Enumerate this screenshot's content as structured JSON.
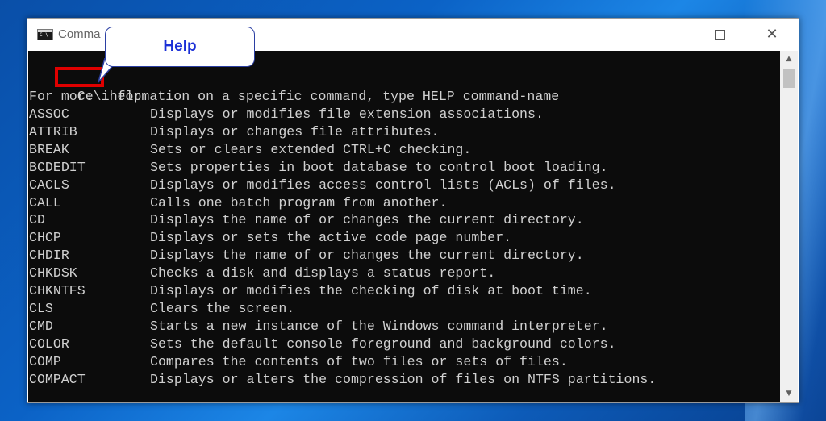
{
  "window": {
    "title": "Comma",
    "icon": "console-icon",
    "controls": {
      "minimize": "minimize-icon",
      "maximize": "maximize-icon",
      "close": "close-icon"
    }
  },
  "callout": {
    "text": "Help"
  },
  "console": {
    "prompt": "C:\\",
    "command": "help",
    "intro": "For more information on a specific command, type HELP command-name",
    "commands": [
      {
        "name": "ASSOC",
        "desc": "Displays or modifies file extension associations."
      },
      {
        "name": "ATTRIB",
        "desc": "Displays or changes file attributes."
      },
      {
        "name": "BREAK",
        "desc": "Sets or clears extended CTRL+C checking."
      },
      {
        "name": "BCDEDIT",
        "desc": "Sets properties in boot database to control boot loading."
      },
      {
        "name": "CACLS",
        "desc": "Displays or modifies access control lists (ACLs) of files."
      },
      {
        "name": "CALL",
        "desc": "Calls one batch program from another."
      },
      {
        "name": "CD",
        "desc": "Displays the name of or changes the current directory."
      },
      {
        "name": "CHCP",
        "desc": "Displays or sets the active code page number."
      },
      {
        "name": "CHDIR",
        "desc": "Displays the name of or changes the current directory."
      },
      {
        "name": "CHKDSK",
        "desc": "Checks a disk and displays a status report."
      },
      {
        "name": "CHKNTFS",
        "desc": "Displays or modifies the checking of disk at boot time."
      },
      {
        "name": "CLS",
        "desc": "Clears the screen."
      },
      {
        "name": "CMD",
        "desc": "Starts a new instance of the Windows command interpreter."
      },
      {
        "name": "COLOR",
        "desc": "Sets the default console foreground and background colors."
      },
      {
        "name": "COMP",
        "desc": "Compares the contents of two files or sets of files."
      },
      {
        "name": "COMPACT",
        "desc": "Displays or alters the compression of files on NTFS partitions."
      }
    ]
  },
  "colors": {
    "console_bg": "#0c0c0c",
    "console_text": "#d0d0d0",
    "highlight": "#e00000",
    "callout_text": "#1a2fd6"
  }
}
